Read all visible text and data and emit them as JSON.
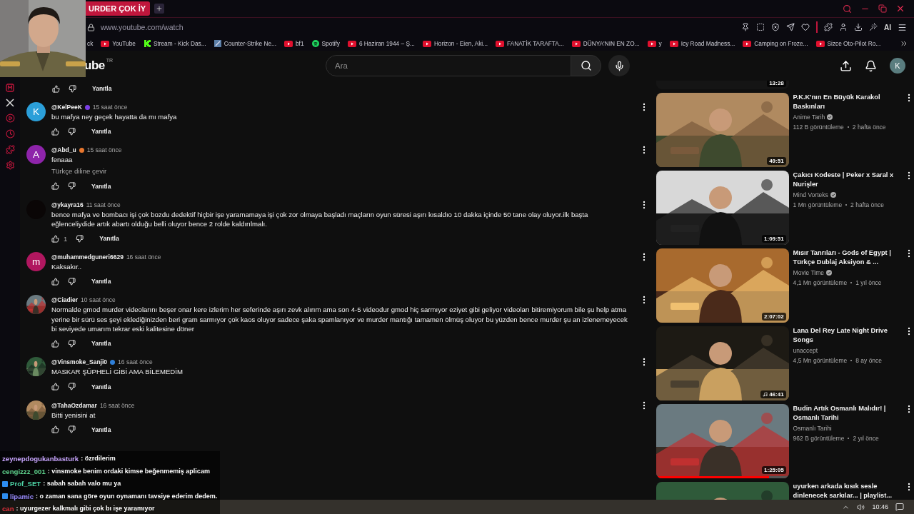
{
  "browser": {
    "tab": {
      "title": "URDER ÇOK İY",
      "selected": true
    },
    "url": "www.youtube.com/watch",
    "ai_label": "AI",
    "bookmarks": [
      {
        "label": "ck",
        "kind": "plain"
      },
      {
        "label": "YouTube",
        "kind": "youtube"
      },
      {
        "label": "Stream - Kick Das...",
        "kind": "kick"
      },
      {
        "label": "Counter-Strike Ne...",
        "kind": "game"
      },
      {
        "label": "bf1",
        "kind": "youtube"
      },
      {
        "label": "Spotify",
        "kind": "spotify"
      },
      {
        "label": "6 Haziran 1944 – Ş...",
        "kind": "youtube"
      },
      {
        "label": "Horizon - Eien, Aki...",
        "kind": "youtube"
      },
      {
        "label": "FANATİK TARAFTA...",
        "kind": "youtube"
      },
      {
        "label": "DÜNYA'NIN EN ZO...",
        "kind": "youtube"
      },
      {
        "label": "y",
        "kind": "youtube"
      },
      {
        "label": "Icy Road Madness...",
        "kind": "youtube"
      },
      {
        "label": "Camping on Froze...",
        "kind": "youtube"
      },
      {
        "label": "Sizce Oto-Pilot Ro...",
        "kind": "youtube"
      }
    ]
  },
  "header": {
    "logo": "ube",
    "region": "TR",
    "search": {
      "placeholder": "Ara"
    },
    "avatar": "K"
  },
  "comments": {
    "first_reply": "Yanıtla",
    "items": [
      {
        "author": "@KelPeeK",
        "badge": {
          "color": "#7b3fe4"
        },
        "time": "15 saat önce",
        "text": "bu mafya ney geçek hayatta da mı mafya",
        "avatar": {
          "kind": "letter",
          "letter": "K",
          "color": "#2b9fd9"
        },
        "reply": "Yanıtla"
      },
      {
        "author": "@Abd_u",
        "badge": {
          "color": "#e8772e"
        },
        "time": "15 saat önce",
        "text": "fenaaa",
        "translate": "Türkçe diline çevir",
        "avatar": {
          "kind": "letter",
          "letter": "A",
          "color": "#8e24aa"
        },
        "reply": "Yanıtla"
      },
      {
        "author": "@ykayra16",
        "time": "11 saat önce",
        "text": "bence mafya ve bombacı işi çok bozdu dedektif hiçbir işe yaramamaya işi çok zor olmaya başladı maçların oyun süresi aşırı kısaldıo 10 dakka içinde 50 tane olay oluyor.ilk başta eğlenceliydide artık abartı olduğu belli oluyor bence 2 rolde kaldırılmalı.",
        "likes": "1",
        "avatar": {
          "kind": "letter",
          "color": "#0a0606"
        },
        "reply": "Yanıtla"
      },
      {
        "author": "@muhammedguneri6629",
        "time": "16 saat önce",
        "text": "Kaksakır..",
        "avatar": {
          "kind": "letter",
          "letter": "m",
          "color": "#b0175f"
        },
        "reply": "Yanıtla"
      },
      {
        "author": "@Ciadier",
        "time": "10 saat önce",
        "text": "Normalde gmod murder videolarını beşer onar kere izlerim her seferinde aşırı zevk alırım ama son 4-5 videodur gmod hiç sarmıyor eziyet gibi geliyor videoları bitiremiyorum bile şu help atma yerine bir sürü ses şeyi eklediğinizden beri gram sarmıyor çok kaos oluyor sadece şaka spamlanıyor ve murder mantığı tamamen ölmüş oluyor bu yüzden bence murder şu an izlenemeyecek bi seviyede umarım tekrar eski kalitesine döner",
        "reply": "Yanıtla"
      },
      {
        "author": "@Vinsmoke_Sanji0",
        "badge": {
          "color": "#2f7fd8"
        },
        "time": "16 saat önce",
        "text": "MASKAR ŞÜPHELİ GİBİ AMA BİLEMEDİM",
        "reply": "Yanıtla"
      },
      {
        "author": "@TahaOzdamar",
        "time": "16 saat önce",
        "text": "Bitti yenisini at",
        "reply": "Yanıtla"
      }
    ]
  },
  "recommendations": {
    "partial_duration": "13:28",
    "items": [
      {
        "title": "P.K.K'nın En Büyük Karakol Baskınları",
        "channel": "Anime Tarih",
        "verified": true,
        "views": "112 B görüntüleme",
        "age": "2 hafta önce",
        "duration": "49:51"
      },
      {
        "title": "Çakıcı Kodeste | Peker x Saral x Nurişler",
        "channel": "Mind Vorteks",
        "verified": true,
        "views": "1 Mn görüntüleme",
        "age": "2 hafta önce",
        "duration": "1:09:51"
      },
      {
        "title": "Mısır Tanrıları - Gods of Egypt | Türkçe Dublaj Aksiyon & ...",
        "channel": "Movie Time",
        "verified": true,
        "views": "4,1 Mn görüntüleme",
        "age": "1 yıl önce",
        "duration": "2:07:02"
      },
      {
        "title": "Lana Del Rey Late Night Drive Songs",
        "channel": "unaccept",
        "views": "4,5 Mn görüntüleme",
        "age": "8 ay önce",
        "duration": "46:41",
        "music": true
      },
      {
        "title": "Budin Artık Osmanlı Malıdır! | Osmanlı Tarihi",
        "channel": "Osmanlı Tarihi",
        "views": "962 B görüntüleme",
        "age": "2 yıl önce",
        "duration": "1:25:05",
        "level": 0.85
      },
      {
        "title": "uyurken arkada kısık sesle dinlenecek sarkılar... | playlist..."
      }
    ]
  },
  "chat": [
    {
      "name": "zeynepdogukanbasturk",
      "color": "#c9a6ff",
      "message": ": özrdilerim"
    },
    {
      "name": "cengizzz_001",
      "color": "#5fd38d",
      "message": ": vinsmoke benim ordaki kimse beğenmemiş aplicam"
    },
    {
      "name": "Prof_SET",
      "color": "#4fd6a8",
      "badges": true,
      "message": ": sabah sabah valo mu ya"
    },
    {
      "name": "lipamic",
      "color": "#9a8cff",
      "badges": true,
      "message": ": o zaman sana göre oyun oynamanı tavsiye ederim dedem."
    },
    {
      "name": "can",
      "color": "#e0303a",
      "message": ": uyurgezer kalkmalı gibi çok bı işe yaramıyor"
    }
  ],
  "taskbar": {
    "time": "10:46"
  }
}
